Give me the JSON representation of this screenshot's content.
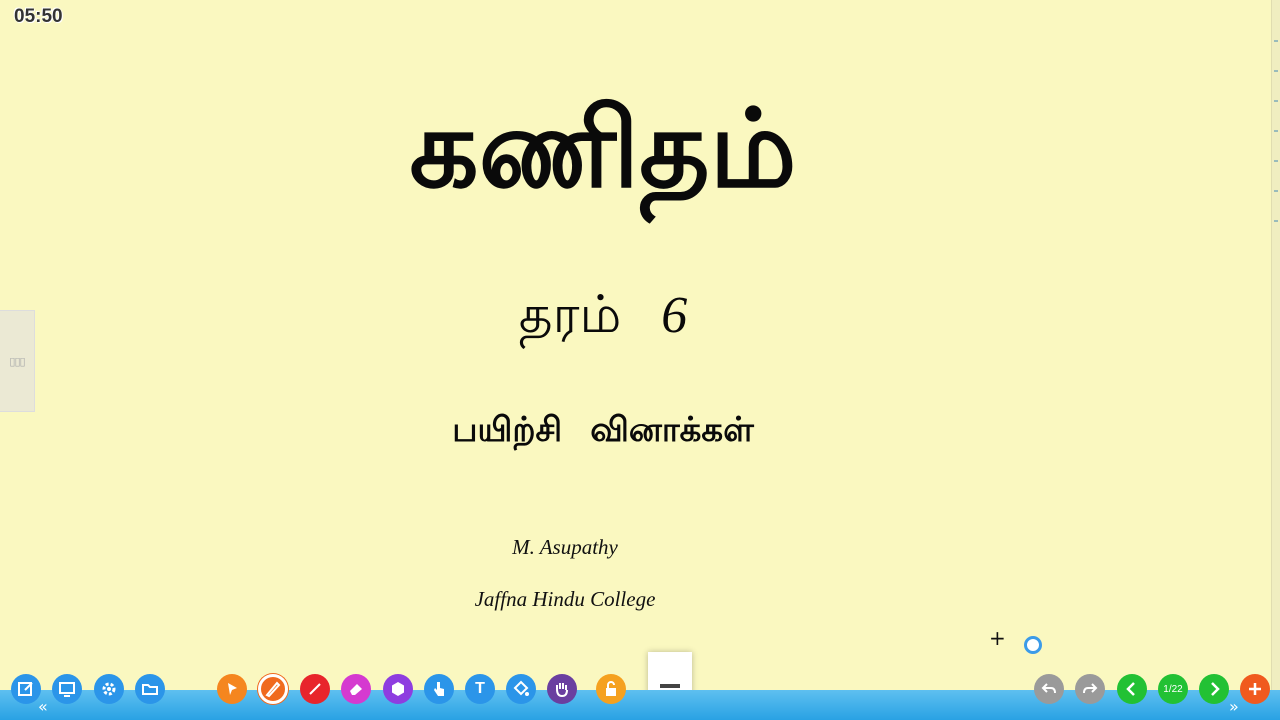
{
  "timer": "05:50",
  "slide": {
    "title": "கணிதம்",
    "grade_word": "தரம்",
    "grade_num": "6",
    "subtitle_words": [
      "பயிற்சி",
      "வினாக்கள்"
    ],
    "author": "M. Asupathy",
    "institution": "Jaffna Hindu College"
  },
  "side_tab_label": "▯▯▯",
  "crosshair": "+",
  "toolbar": {
    "left_chevron": "«",
    "right_chevron": "»",
    "page_indicator": "1/22",
    "text_tool_glyph": "T",
    "colors": {
      "file_tools": "#2b95e9",
      "select": "#f5861f",
      "pen": "#f06a1e",
      "line": "#e8252b",
      "eraser": "#d53ad0",
      "shape": "#8e3de0",
      "pointer": "#2b95e9",
      "text": "#2b95e9",
      "fill": "#2b95e9",
      "hand": "#6a3fa0",
      "lock": "#f5a11f",
      "undo_redo": "#9a9a9a",
      "nav": "#22c134",
      "add": "#f05a1e"
    },
    "icons": [
      "edit-icon",
      "screen-icon",
      "gear-icon",
      "folder-icon",
      "select-arrow-icon",
      "pen-icon",
      "line-icon",
      "eraser-icon",
      "shape-icon",
      "pointer-hand-icon",
      "text-icon",
      "fill-icon",
      "pan-hand-icon",
      "lock-icon",
      "undo-icon",
      "redo-icon",
      "prev-page-icon",
      "next-page-icon",
      "add-page-icon"
    ]
  }
}
